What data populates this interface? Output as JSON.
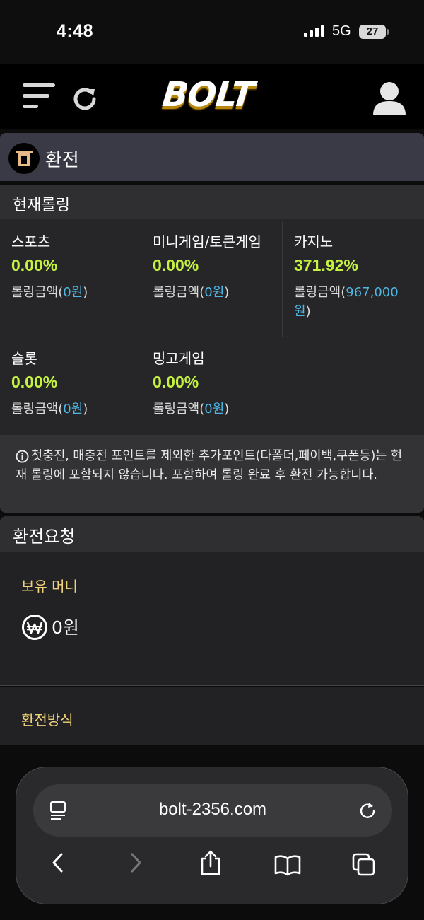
{
  "status_bar": {
    "time": "4:48",
    "network": "5G",
    "battery": "27"
  },
  "header": {
    "logo": "BOLT",
    "icons": [
      "menu-icon",
      "refresh-icon",
      "user-icon"
    ]
  },
  "page": {
    "title": "환전"
  },
  "rolling": {
    "heading": "현재롤링",
    "items": [
      {
        "name": "스포츠",
        "percent": "0.00%",
        "amount_label": "롤링금액(",
        "amount": "0원",
        "amount_close": ")"
      },
      {
        "name": "미니게임/토큰게임",
        "percent": "0.00%",
        "amount_label": "롤링금액(",
        "amount": "0원",
        "amount_close": ")"
      },
      {
        "name": "카지노",
        "percent": "371.92%",
        "amount_label": "롤링금액(",
        "amount": "967,000원",
        "amount_close": ")"
      },
      {
        "name": "슬롯",
        "percent": "0.00%",
        "amount_label": "롤링금액(",
        "amount": "0원",
        "amount_close": ")"
      },
      {
        "name": "밍고게임",
        "percent": "0.00%",
        "amount_label": "롤링금액(",
        "amount": "0원",
        "amount_close": ")"
      }
    ],
    "notice": "첫충전, 매충전 포인트를 제외한 추가포인트(다폴더,페이백,쿠폰등)는 현재 롤링에 포함되지 않습니다. 포함하여 롤링 완료 후 환전 가능합니다."
  },
  "request": {
    "heading": "환전요청",
    "money_label": "보유 머니",
    "balance": "0원",
    "method_label": "환전방식"
  },
  "browser": {
    "url": "bolt-2356.com"
  },
  "colors": {
    "accent_green": "#c5f240",
    "link_blue": "#4cb8e6",
    "gold": "#f0d27a"
  }
}
